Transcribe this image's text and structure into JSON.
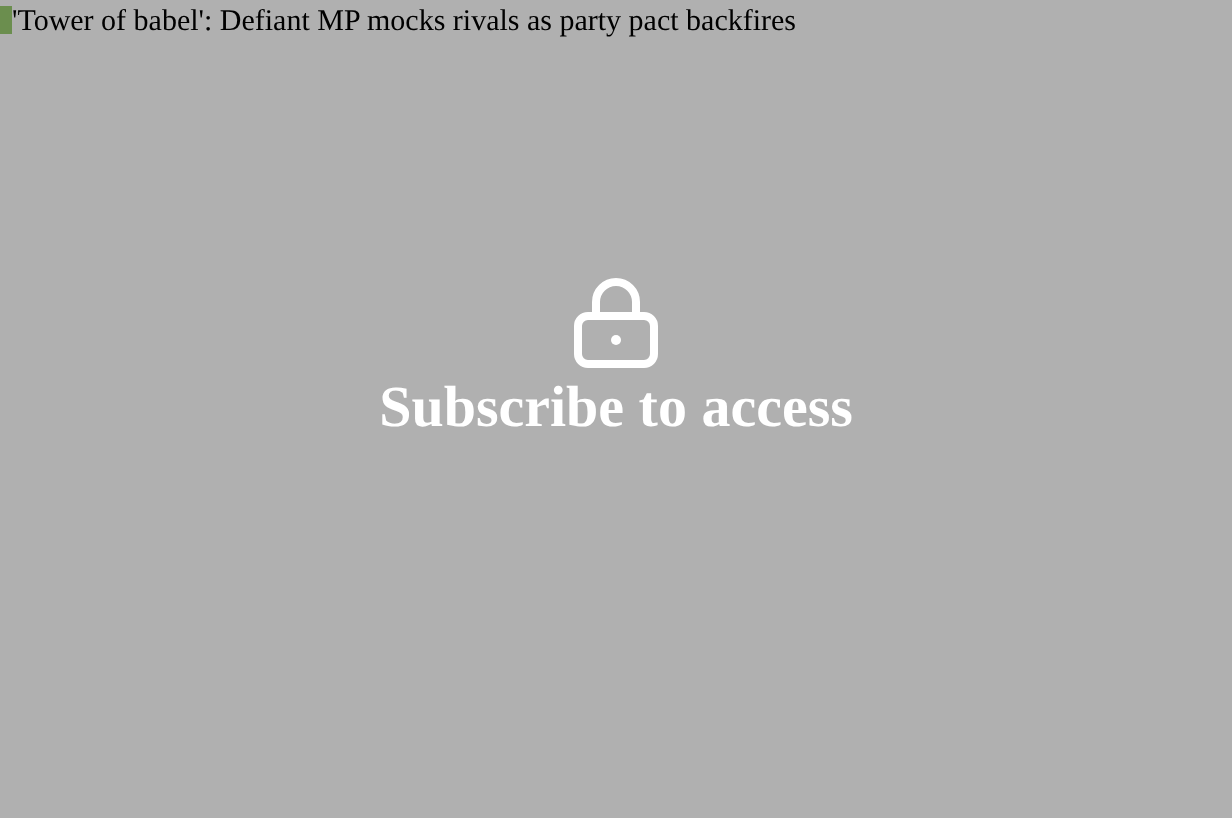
{
  "image_alt": "'Tower of babel': Defiant MP mocks rivals as party pact backfires",
  "overlay": {
    "message": "Subscribe to access"
  }
}
